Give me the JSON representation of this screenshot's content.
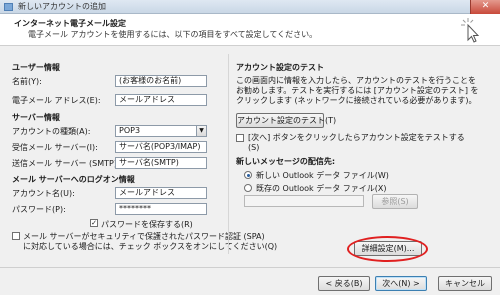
{
  "window": {
    "title": "新しいアカウントの追加",
    "close_glyph": "✕"
  },
  "header": {
    "title": "インターネット電子メール設定",
    "subtitle": "電子メール アカウントを使用するには、以下の項目をすべて設定してください。"
  },
  "user_info": {
    "section": "ユーザー情報",
    "name_label": "名前(Y):",
    "name_value": "(お客様のお名前)",
    "email_label": "電子メール アドレス(E):",
    "email_value": "メールアドレス"
  },
  "server_info": {
    "section": "サーバー情報",
    "type_label": "アカウントの種類(A):",
    "type_value": "POP3",
    "incoming_label": "受信メール サーバー(I):",
    "incoming_value": "サーバ名(POP3/IMAP)",
    "outgoing_label": "送信メール サーバー (SMTP)(O):",
    "outgoing_value": "サーバ名(SMTP)"
  },
  "login_info": {
    "section": "メール サーバーへのログオン情報",
    "account_label": "アカウント名(U):",
    "account_value": "メールアドレス",
    "password_label": "パスワード(P):",
    "password_value": "********",
    "remember_label": "パスワードを保存する(R)",
    "spa_line1": "メール サーバーがセキュリティで保護されたパスワード認証 (SPA)",
    "spa_line2": "に対応している場合には、チェック ボックスをオンにしてください(Q)"
  },
  "test": {
    "section": "アカウント設定のテスト",
    "desc_line1": "この画面内に情報を入力したら、アカウントのテストを行うことを",
    "desc_line2": "お勧めします。テストを実行するには [アカウント設定のテスト] を",
    "desc_line3": "クリックします (ネットワークに接続されている必要があります)。",
    "button": "アカウント設定のテスト(T)",
    "auto_line1": "[次へ] ボタンをクリックしたらアカウント設定をテストする",
    "auto_line2": "(S)"
  },
  "delivery": {
    "section": "新しいメッセージの配信先:",
    "new_file": "新しい Outlook データ ファイル(W)",
    "existing_file": "既存の Outlook データ ファイル(X)",
    "browse": "参照(S)"
  },
  "buttons": {
    "more_settings": "詳細設定(M)...",
    "back": "< 戻る(B)",
    "next": "次へ(N) >",
    "cancel": "キャンセル"
  }
}
